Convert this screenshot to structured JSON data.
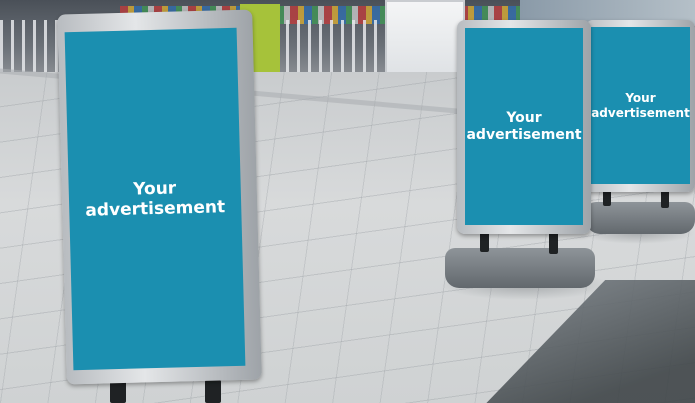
{
  "scene": {
    "description_type": "photo",
    "signs": [
      {
        "id": "sign-front",
        "lines": [
          "Your",
          "advertisement"
        ],
        "panel_color": "#1b8fb0"
      },
      {
        "id": "sign-middle",
        "lines": [
          "Your",
          "advertisement"
        ],
        "panel_color": "#1b8fb0"
      },
      {
        "id": "sign-back",
        "lines": [
          "Your",
          "advertisement"
        ],
        "panel_color": "#1b8fb0"
      }
    ]
  }
}
